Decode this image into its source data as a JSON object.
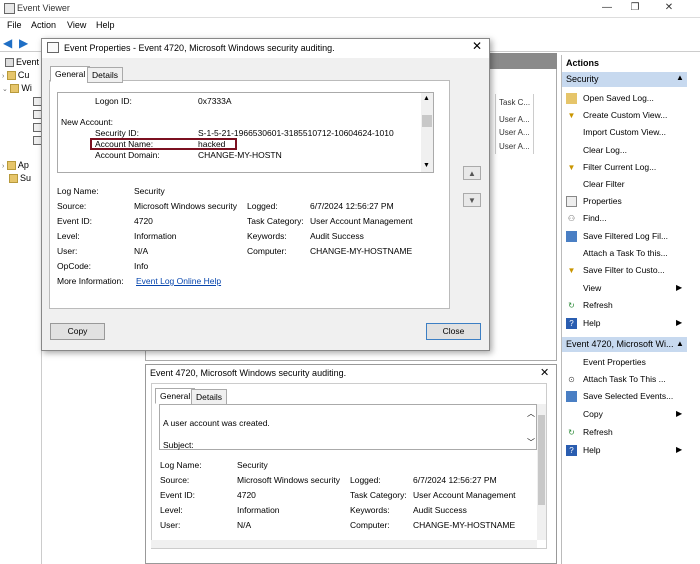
{
  "app": {
    "title": "Event Viewer"
  },
  "menu": [
    "File",
    "Action",
    "View",
    "Help"
  ],
  "tree": {
    "items": [
      "Event",
      "Cu",
      "Wi",
      "Ap",
      "Su"
    ]
  },
  "center": {
    "task_col_header": "Task C...",
    "task_values": [
      "User A...",
      "User A...",
      "User A..."
    ]
  },
  "dialog": {
    "title": "Event Properties - Event 4720, Microsoft Windows security auditing.",
    "tabs": [
      "General",
      "Details"
    ],
    "desc": {
      "logon_id_label": "Logon ID:",
      "logon_id_value": "0x7333A",
      "new_account_label": "New Account:",
      "security_id_label": "Security ID:",
      "security_id_value": "S-1-5-21-1966530601-3185510712-10604624-1010",
      "account_name_label": "Account Name:",
      "account_name_value": "hacked",
      "account_domain_label": "Account Domain:",
      "account_domain_value": "CHANGE-MY-HOSTN"
    },
    "fields": {
      "log_name_label": "Log Name:",
      "log_name": "Security",
      "source_label": "Source:",
      "source": "Microsoft Windows security",
      "logged_label": "Logged:",
      "logged": "6/7/2024 12:56:27 PM",
      "event_id_label": "Event ID:",
      "event_id": "4720",
      "task_cat_label": "Task Category:",
      "task_cat": "User Account Management",
      "level_label": "Level:",
      "level": "Information",
      "keywords_label": "Keywords:",
      "keywords": "Audit Success",
      "user_label": "User:",
      "user": "N/A",
      "computer_label": "Computer:",
      "computer": "CHANGE-MY-HOSTNAME",
      "opcode_label": "OpCode:",
      "opcode": "Info",
      "more_info_label": "More Information:",
      "more_info_link": "Event Log Online Help"
    },
    "copy_label": "Copy",
    "close_label": "Close"
  },
  "bottom": {
    "title": "Event 4720, Microsoft Windows security auditing.",
    "tabs": [
      "General",
      "Details"
    ],
    "desc_line1": "A user account was created.",
    "desc_line2": "Subject:",
    "fields": {
      "log_name_label": "Log Name:",
      "log_name": "Security",
      "source_label": "Source:",
      "source": "Microsoft Windows security",
      "logged_label": "Logged:",
      "logged": "6/7/2024 12:56:27 PM",
      "event_id_label": "Event ID:",
      "event_id": "4720",
      "task_cat_label": "Task Category:",
      "task_cat": "User Account Management",
      "level_label": "Level:",
      "level": "Information",
      "keywords_label": "Keywords:",
      "keywords": "Audit Success",
      "user_label": "User:",
      "user": "N/A",
      "computer_label": "Computer:",
      "computer": "CHANGE-MY-HOSTNAME"
    }
  },
  "actions": {
    "header": "Actions",
    "section1": "Security",
    "items1": [
      "Open Saved Log...",
      "Create Custom View...",
      "Import Custom View...",
      "Clear Log...",
      "Filter Current Log...",
      "Clear Filter",
      "Properties",
      "Find...",
      "Save Filtered Log Fil...",
      "Attach a Task To this...",
      "Save Filter to Custo...",
      "View",
      "Refresh",
      "Help"
    ],
    "section2": "Event 4720, Microsoft Wi...",
    "items2": [
      "Event Properties",
      "Attach Task To This ...",
      "Save Selected Events...",
      "Copy",
      "Refresh",
      "Help"
    ]
  },
  "colors": {
    "highlight": "#7b1020",
    "section": "#c7d9ef",
    "link": "#0645ad"
  }
}
